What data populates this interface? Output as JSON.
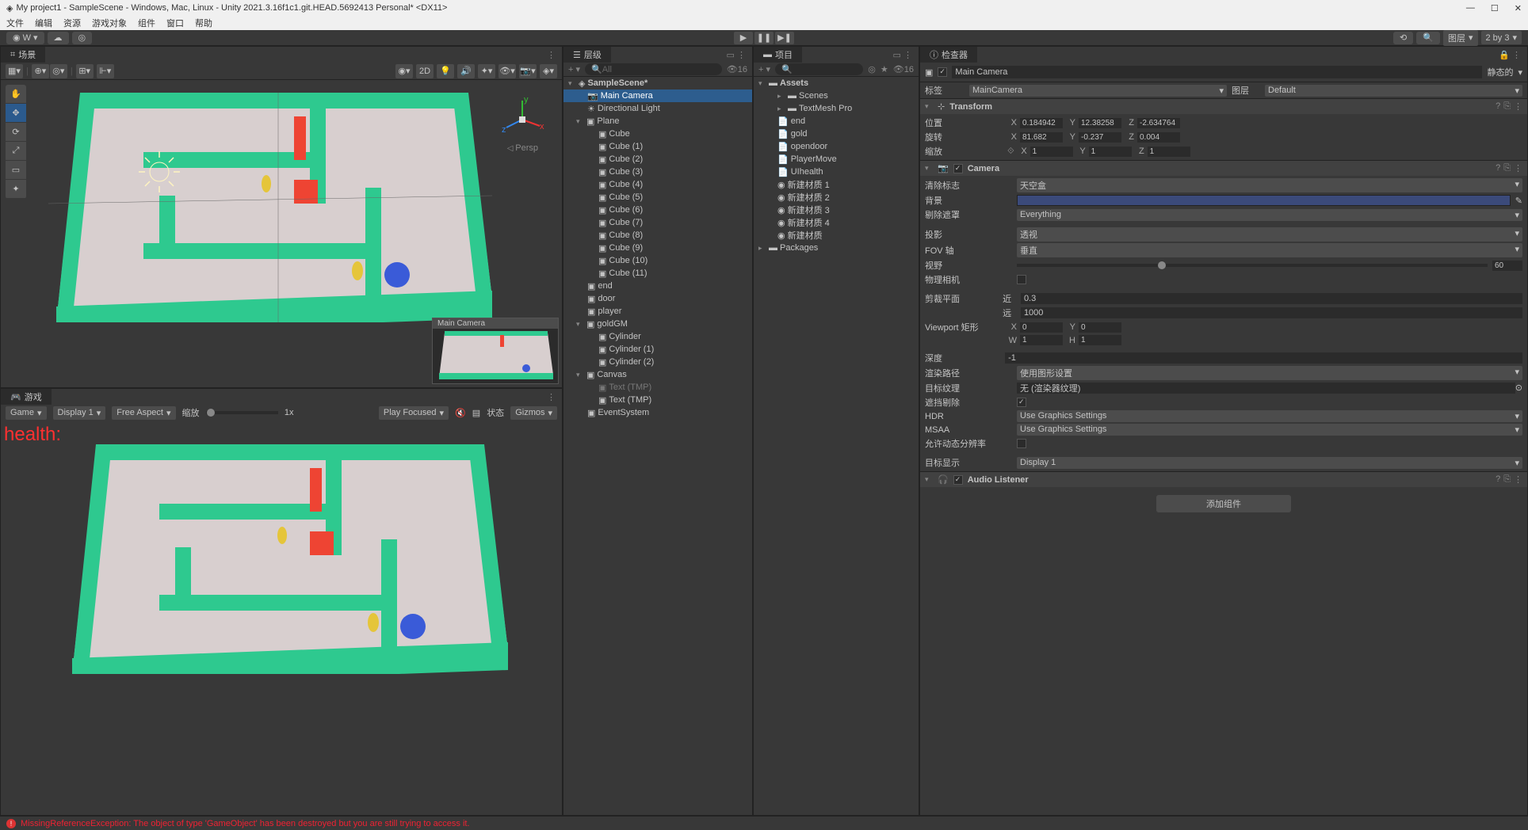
{
  "titlebar": {
    "title": "My project1 - SampleScene - Windows, Mac, Linux - Unity 2021.3.16f1c1.git.HEAD.5692413 Personal* <DX11>"
  },
  "menubar": [
    "文件",
    "编辑",
    "资源",
    "游戏对象",
    "组件",
    "窗口",
    "帮助"
  ],
  "toolbar": {
    "account": "W",
    "layers_label": "图层",
    "layout": "2 by 3"
  },
  "scene": {
    "tab": "场景",
    "mode_2d": "2D",
    "persp": "Persp",
    "camera_preview": "Main Camera"
  },
  "game": {
    "tab": "游戏",
    "game_dd": "Game",
    "display": "Display 1",
    "aspect": "Free Aspect",
    "scale_label": "缩放",
    "scale": "1x",
    "play_focused": "Play Focused",
    "status": "状态",
    "gizmos": "Gizmos",
    "health": "health:"
  },
  "hierarchy": {
    "tab": "层级",
    "search_placeholder": "All",
    "counter": "16",
    "scene_name": "SampleScene*",
    "items": [
      {
        "name": "Main Camera",
        "selected": true,
        "icon": "camera"
      },
      {
        "name": "Directional Light",
        "icon": "light"
      },
      {
        "name": "Plane",
        "expanded": true,
        "icon": "cube",
        "children": [
          "Cube",
          "Cube (1)",
          "Cube (2)",
          "Cube (3)",
          "Cube (4)",
          "Cube (5)",
          "Cube (6)",
          "Cube (7)",
          "Cube (8)",
          "Cube (9)",
          "Cube (10)",
          "Cube (11)"
        ]
      },
      {
        "name": "end",
        "icon": "cube"
      },
      {
        "name": "door",
        "icon": "cube"
      },
      {
        "name": "player",
        "icon": "cube"
      },
      {
        "name": "goldGM",
        "expanded": true,
        "icon": "cube",
        "children": [
          "Cylinder",
          "Cylinder (1)",
          "Cylinder (2)"
        ]
      },
      {
        "name": "Canvas",
        "expanded": true,
        "icon": "cube",
        "children_muted": [
          "Text (TMP)"
        ],
        "children": [
          "Text (TMP)"
        ]
      },
      {
        "name": "EventSystem",
        "icon": "cube"
      }
    ]
  },
  "project": {
    "tab": "项目",
    "search_placeholder": "",
    "counter": "16",
    "root": "Assets",
    "items": [
      {
        "name": "Scenes",
        "type": "folder"
      },
      {
        "name": "TextMesh Pro",
        "type": "folder"
      },
      {
        "name": "end",
        "type": "file"
      },
      {
        "name": "gold",
        "type": "file"
      },
      {
        "name": "opendoor",
        "type": "file"
      },
      {
        "name": "PlayerMove",
        "type": "file"
      },
      {
        "name": "UIhealth",
        "type": "file"
      },
      {
        "name": "新建材质 1",
        "type": "material"
      },
      {
        "name": "新建材质 2",
        "type": "material"
      },
      {
        "name": "新建材质 3",
        "type": "material"
      },
      {
        "name": "新建材质 4",
        "type": "material"
      },
      {
        "name": "新建材质",
        "type": "material"
      }
    ],
    "packages": "Packages"
  },
  "inspector": {
    "tab": "检查器",
    "static": "静态的",
    "name": "Main Camera",
    "tag_label": "标签",
    "tag": "MainCamera",
    "layer_label": "图层",
    "layer": "Default",
    "transform": {
      "title": "Transform",
      "pos_label": "位置",
      "pos": {
        "x": "0.184942",
        "y": "12.38258",
        "z": "-2.634764"
      },
      "rot_label": "旋转",
      "rot": {
        "x": "81.682",
        "y": "-0.237",
        "z": "0.004"
      },
      "scale_label": "缩放",
      "scale": {
        "x": "1",
        "y": "1",
        "z": "1"
      }
    },
    "camera": {
      "title": "Camera",
      "clear_flags_label": "清除标志",
      "clear_flags": "天空盒",
      "background_label": "背景",
      "culling_label": "剔除遮罩",
      "culling": "Everything",
      "projection_label": "投影",
      "projection": "透视",
      "fov_axis_label": "FOV 轴",
      "fov_axis": "垂直",
      "fov_label": "视野",
      "fov": "60",
      "phys_cam_label": "物理相机",
      "clip_label": "剪裁平面",
      "near_label": "近",
      "near": "0.3",
      "far_label": "远",
      "far": "1000",
      "viewport_label": "Viewport 矩形",
      "viewport": {
        "x": "0",
        "y": "0",
        "w": "1",
        "h": "1"
      },
      "depth_label": "深度",
      "depth": "-1",
      "render_path_label": "渲染路径",
      "render_path": "使用图形设置",
      "target_tex_label": "目标纹理",
      "target_tex": "无 (渲染器纹理)",
      "occ_cull_label": "遮挡剔除",
      "hdr_label": "HDR",
      "hdr": "Use Graphics Settings",
      "msaa_label": "MSAA",
      "msaa": "Use Graphics Settings",
      "dyn_res_label": "允许动态分辨率",
      "target_disp_label": "目标显示",
      "target_disp": "Display 1"
    },
    "audio": {
      "title": "Audio Listener"
    },
    "add_component": "添加组件"
  },
  "console": {
    "error": "MissingReferenceException: The object of type 'GameObject' has been destroyed but you are still trying to access it."
  }
}
